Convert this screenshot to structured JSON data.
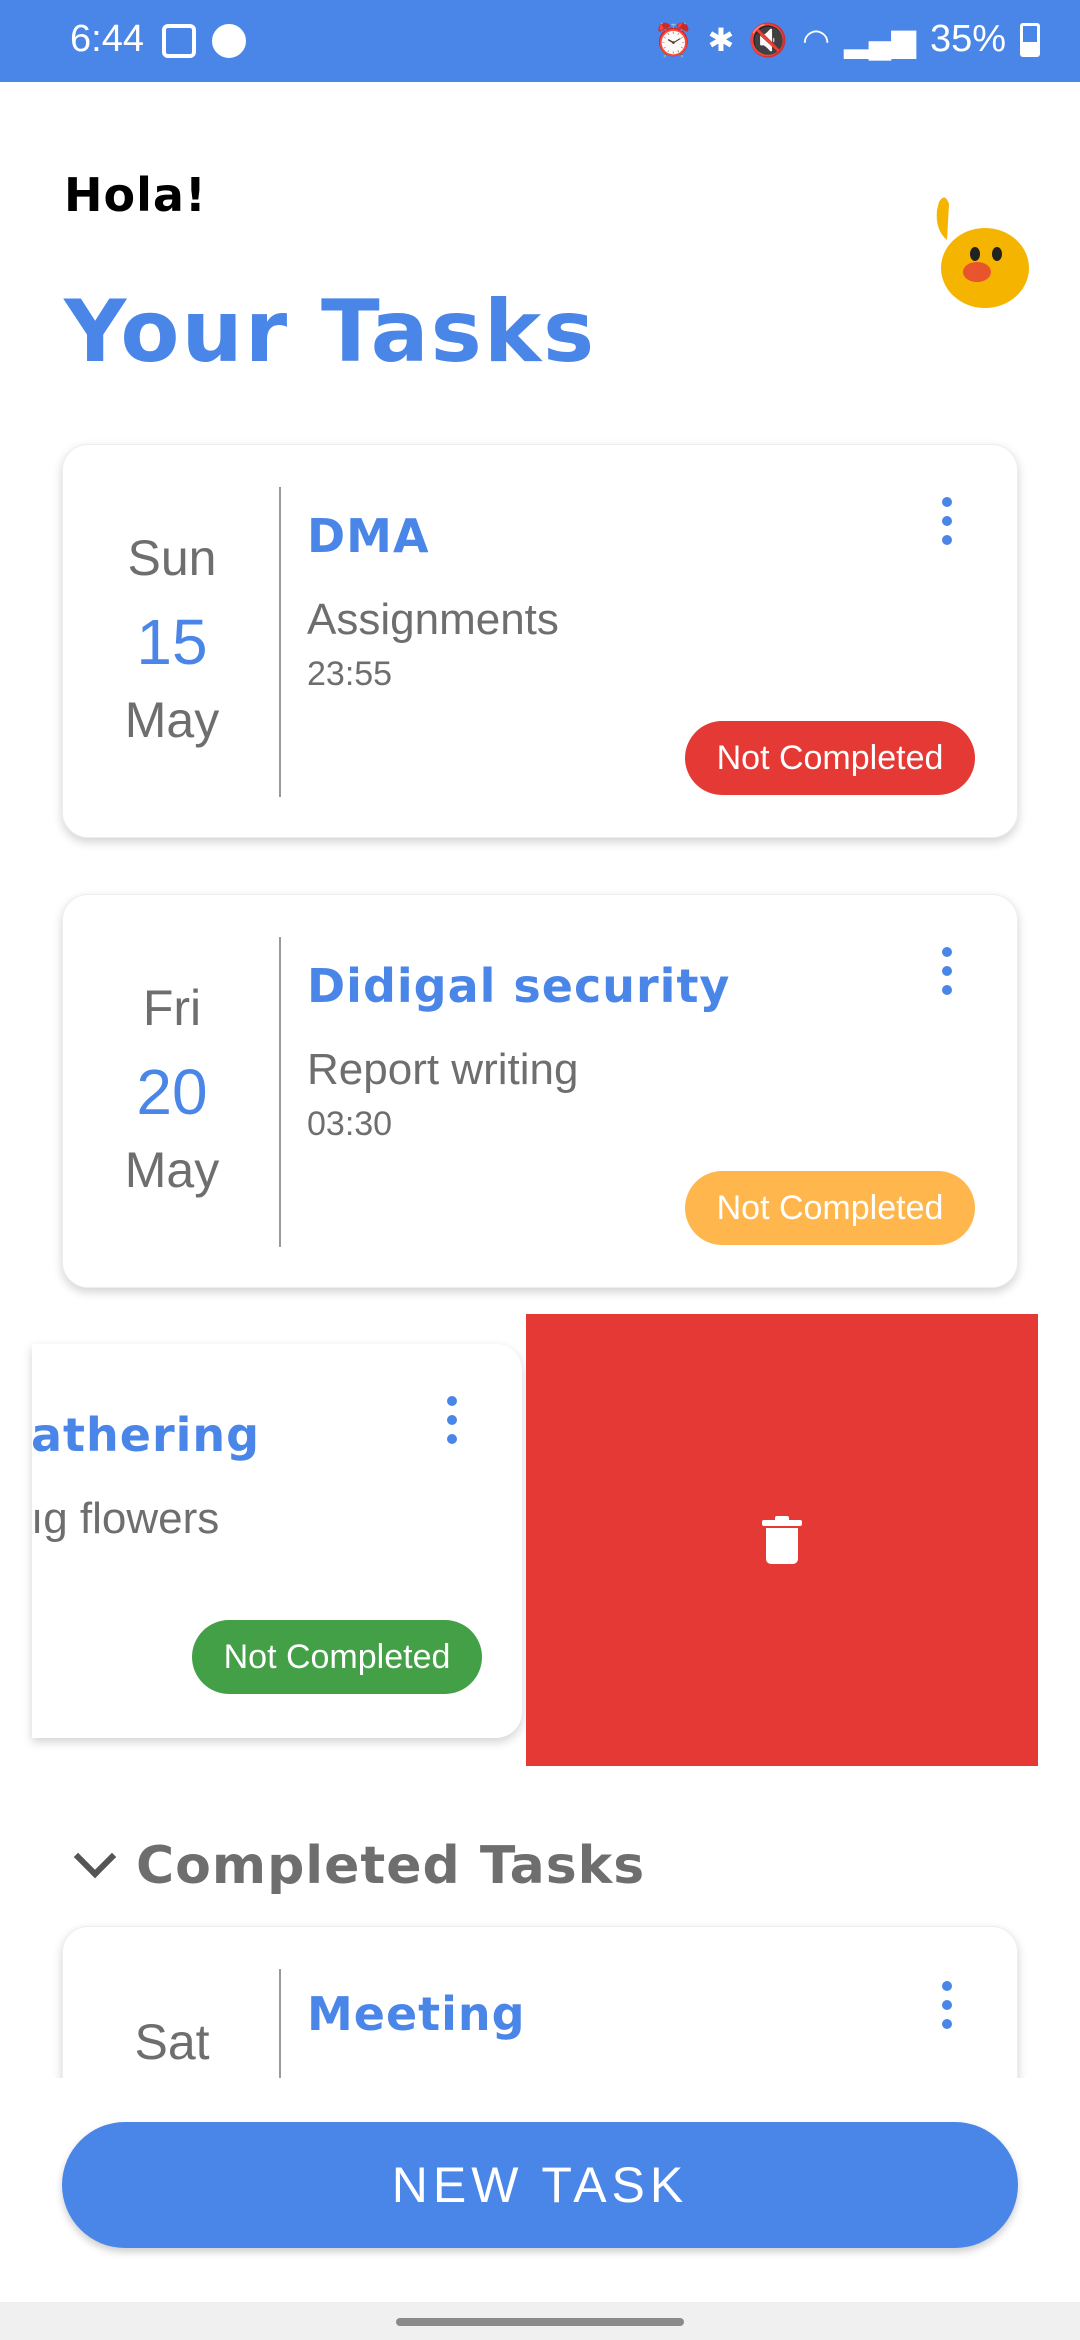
{
  "status_bar": {
    "time": "6:44",
    "battery": "35%",
    "icons": [
      "gallery-icon",
      "app-icon",
      "alarm-icon",
      "bluetooth-icon",
      "mute-icon",
      "wifi-icon",
      "signal-icon",
      "battery-icon"
    ]
  },
  "header": {
    "greeting": "Hola!",
    "title": "Your Tasks"
  },
  "tasks": [
    {
      "day": "Sun",
      "date": "15",
      "month": "May",
      "title": "DMA",
      "description": "Assignments",
      "time": "23:55",
      "status": "Not Completed",
      "status_color": "#e53935"
    },
    {
      "day": "Fri",
      "date": "20",
      "month": "May",
      "title": "Didigal security",
      "description": "Report writing",
      "time": "03:30",
      "status": "Not Completed",
      "status_color": "#ffb74d"
    },
    {
      "title": "athering",
      "description": "ıg flowers",
      "status": "Not Completed",
      "status_color": "#43a047"
    }
  ],
  "completed": {
    "header": "Completed Tasks",
    "items": [
      {
        "day": "Sat",
        "title": "Meeting"
      }
    ]
  },
  "new_task_label": "NEW TASK",
  "colors": {
    "accent": "#4a86e8",
    "delete": "#e53935"
  }
}
